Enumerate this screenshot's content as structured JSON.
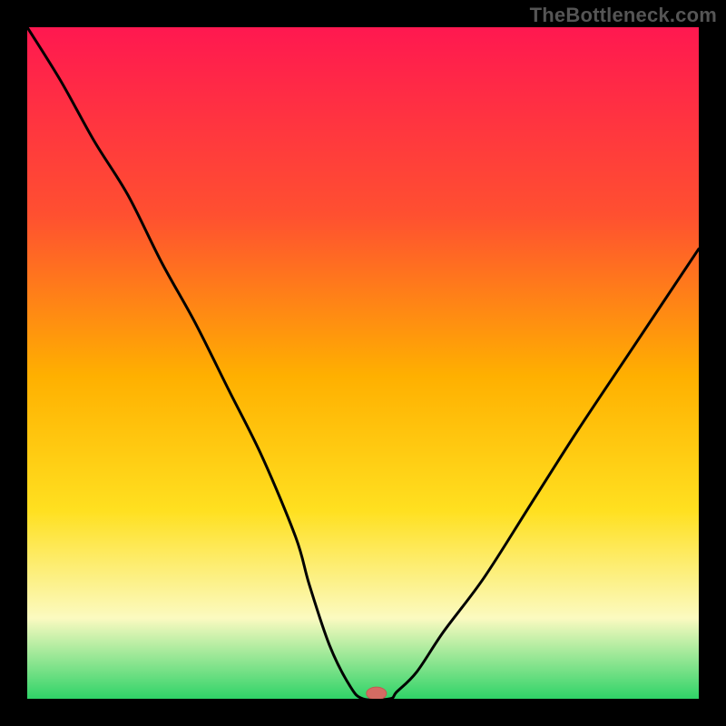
{
  "watermark": "TheBottleneck.com",
  "colors": {
    "frame": "#000000",
    "gradient_top": "#ff1850",
    "gradient_upper": "#ff5030",
    "gradient_mid": "#ffb000",
    "gradient_lower": "#ffe020",
    "gradient_pale": "#fbfac0",
    "gradient_bottom": "#2fd368",
    "curve": "#000000",
    "marker_fill": "#d46b63",
    "marker_stroke": "#c25a52"
  },
  "chart_data": {
    "type": "line",
    "title": "",
    "xlabel": "",
    "ylabel": "",
    "xlim": [
      0,
      100
    ],
    "ylim": [
      0,
      100
    ],
    "x": [
      0,
      5,
      10,
      15,
      20,
      25,
      30,
      35,
      40,
      42,
      45,
      48,
      50,
      54,
      55,
      58,
      62,
      68,
      75,
      82,
      90,
      100
    ],
    "y": [
      100,
      92,
      83,
      75,
      65,
      56,
      46,
      36,
      24,
      17,
      8,
      2,
      0,
      0,
      1,
      4,
      10,
      18,
      29,
      40,
      52,
      67
    ],
    "marker": {
      "x": 52,
      "y": 0.8
    },
    "flat_segment": {
      "x0": 48,
      "x1": 54,
      "y": 0
    },
    "gradient_stops": [
      {
        "pct": 0.0,
        "color": "#ff1850"
      },
      {
        "pct": 0.28,
        "color": "#ff5030"
      },
      {
        "pct": 0.52,
        "color": "#ffb000"
      },
      {
        "pct": 0.72,
        "color": "#ffe020"
      },
      {
        "pct": 0.88,
        "color": "#fbfac0"
      },
      {
        "pct": 1.0,
        "color": "#2fd368"
      }
    ]
  }
}
